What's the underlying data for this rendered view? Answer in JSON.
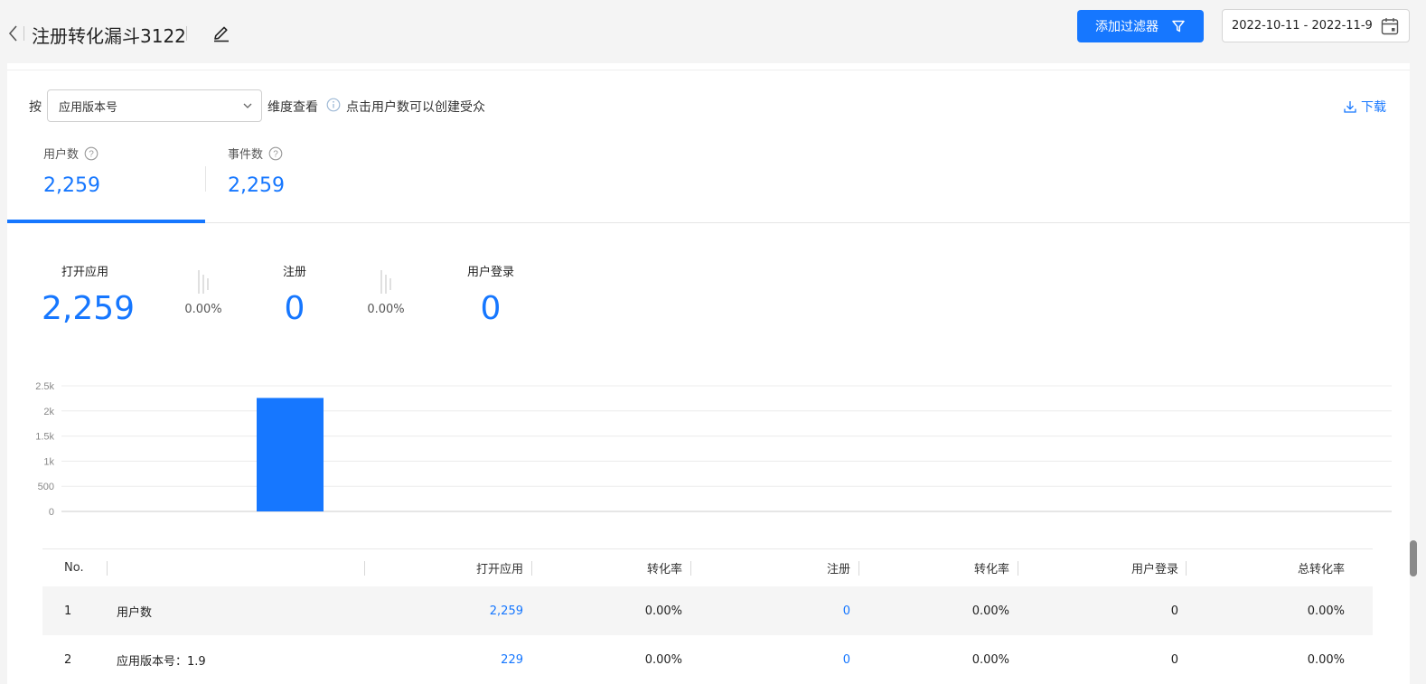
{
  "header": {
    "title": "注册转化漏斗3122",
    "filter_button": "添加过滤器",
    "date_range": "2022-10-11 - 2022-11-9"
  },
  "toolbar": {
    "by_label": "按",
    "dimension_select": "应用版本号",
    "dimension_suffix": "维度查看",
    "hint": "点击用户数可以创建受众",
    "download": "下载"
  },
  "metric_tabs": [
    {
      "label": "用户数",
      "value": "2,259",
      "active": true
    },
    {
      "label": "事件数",
      "value": "2,259",
      "active": false
    }
  ],
  "funnel": {
    "steps": [
      {
        "label": "打开应用",
        "value": "2,259"
      },
      {
        "label": "注册",
        "value": "0"
      },
      {
        "label": "用户登录",
        "value": "0"
      }
    ],
    "rates": [
      "0.00%",
      "0.00%"
    ]
  },
  "chart_data": {
    "type": "bar",
    "categories": [
      "用户数"
    ],
    "values": [
      2259
    ],
    "yticks": [
      "0",
      "500",
      "1k",
      "1.5k",
      "2k",
      "2.5k"
    ],
    "ylim": [
      0,
      2500
    ],
    "bar_color": "#1677ff",
    "grid": true
  },
  "table": {
    "headers": [
      "No.",
      "",
      "打开应用",
      "转化率",
      "注册",
      "转化率",
      "用户登录",
      "总转化率"
    ],
    "rows": [
      [
        "1",
        "用户数",
        "2,259",
        "0.00%",
        "0",
        "0.00%",
        "0",
        "0.00%"
      ],
      [
        "2",
        "应用版本号：1.9",
        "229",
        "0.00%",
        "0",
        "0.00%",
        "0",
        "0.00%"
      ]
    ]
  },
  "colors": {
    "accent": "#1677ff",
    "background": "#f4f4f4"
  }
}
